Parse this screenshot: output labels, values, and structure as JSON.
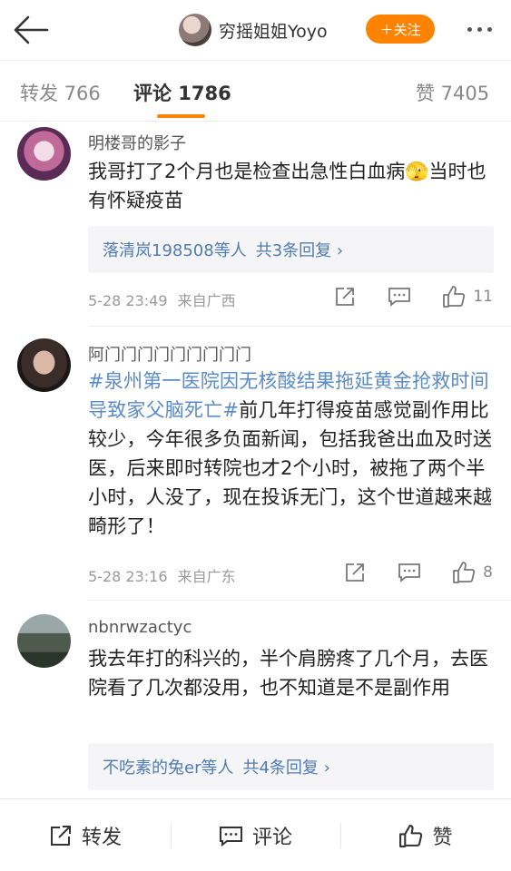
{
  "header": {
    "user_name": "穷摇姐姐Yoyo",
    "follow_label": "＋关注",
    "brand_color": "#ff8200"
  },
  "tabs": [
    {
      "label": "转发 766"
    },
    {
      "label": "评论 1786"
    },
    {
      "label": "赞 7405"
    }
  ],
  "comments": [
    {
      "user": "明楼哥的影子",
      "text": "我哥打了2个月也是检查出急性白血病🫣当时也有怀疑疫苗",
      "replies_who": "落清岚198508等人",
      "replies_count": "共3条回复 ›",
      "time": "5-28 23:49",
      "source": "来自广西",
      "likes": "11"
    },
    {
      "user": "阿门门门门门门门门门",
      "tag": "#泉州第一医院因无核酸结果拖延黄金抢救时间导致家父脑死亡#",
      "text": "前几年打得疫苗感觉副作用比较少，今年很多负面新闻，包括我爸出血及时送医，后来即时转院也才2个小时，被拖了两个半小时，人没了，现在投诉无门，这个世道越来越畸形了！",
      "time": "5-28 23:16",
      "source": "来自广东",
      "likes": "8"
    },
    {
      "user": "nbnrwzactyc",
      "text": "我去年打的科兴的，半个肩膀疼了几个月，去医院看了几次都没用，也不知道是不是副作用",
      "replies_who": "不吃素的兔er等人",
      "replies_count": "共4条回复 ›"
    }
  ],
  "bottom": {
    "repost": "转发",
    "comment": "评论",
    "like": "赞"
  }
}
